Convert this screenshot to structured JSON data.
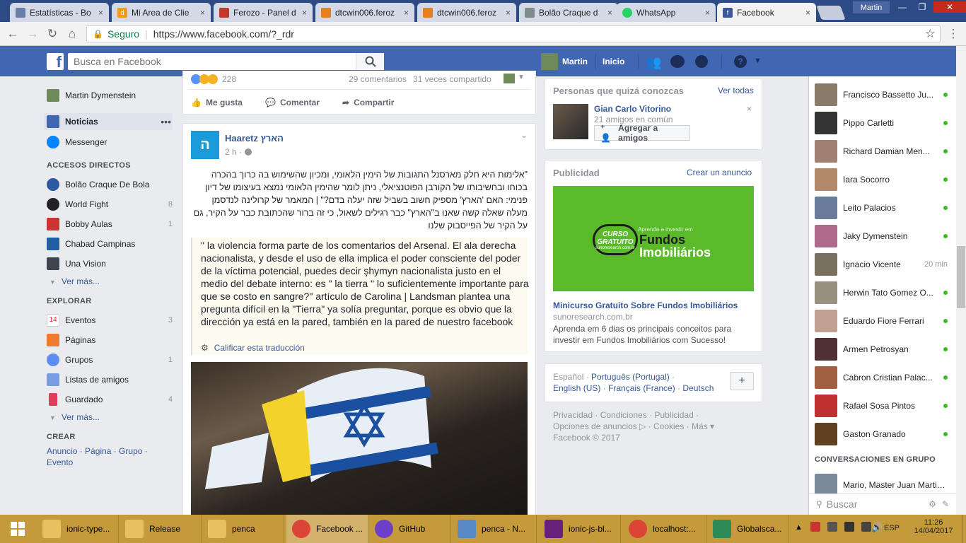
{
  "browser": {
    "tabs": [
      {
        "title": "Estatísticas - Bo",
        "fav_color": "#6a7fa8"
      },
      {
        "title": "Mi Area de Clie",
        "fav_color": "#f39c12"
      },
      {
        "title": "Ferozo - Panel d",
        "fav_color": "#c0392b"
      },
      {
        "title": "dtcwin006.feroz",
        "fav_color": "#e67e22"
      },
      {
        "title": "dtcwin006.feroz",
        "fav_color": "#e67e22"
      },
      {
        "title": "Bolão Craque d",
        "fav_color": "#7f8c8d"
      },
      {
        "title": "WhatsApp",
        "fav_color": "#25d366"
      },
      {
        "title": "Facebook",
        "fav_color": "#3b5998"
      }
    ],
    "user": "Martin",
    "secure_label": "Seguro",
    "url": "https://www.facebook.com/?_rdr"
  },
  "fb_header": {
    "search_placeholder": "Busca en Facebook",
    "user_name": "Martin",
    "home": "Inicio"
  },
  "left_nav": {
    "profile": "Martin Dymenstein",
    "news": "Noticias",
    "messenger": "Messenger",
    "shortcuts_title": "ACCESOS DIRECTOS",
    "shortcuts": [
      {
        "label": "Bolão Craque De Bola",
        "count": ""
      },
      {
        "label": "World Fight",
        "count": "8"
      },
      {
        "label": "Bobby Aulas",
        "count": "1"
      },
      {
        "label": "Chabad Campinas",
        "count": ""
      },
      {
        "label": "Una Vision",
        "count": ""
      }
    ],
    "see_more": "Ver más...",
    "explore_title": "EXPLORAR",
    "explore": [
      {
        "label": "Eventos",
        "count": "3"
      },
      {
        "label": "Páginas",
        "count": ""
      },
      {
        "label": "Grupos",
        "count": "1"
      },
      {
        "label": "Listas de amigos",
        "count": ""
      },
      {
        "label": "Guardado",
        "count": "4"
      }
    ],
    "see_more2": "Ver más...",
    "create_title": "CREAR",
    "create_line1": "Anuncio · Página · Grupo ·",
    "create_line2": "Evento"
  },
  "prev_post": {
    "reactions": "228",
    "comments": "29 comentarios",
    "shares": "31 veces compartido",
    "like": "Me gusta",
    "comment": "Comentar",
    "share": "Compartir"
  },
  "post": {
    "page_name": "Haaretz הארץ",
    "time": "2 h ·",
    "hebrew": "\"אלימות היא חלק מארסנל התגובות של הימין הלאומי, ומכיון שהשימוש בה כרוך בהכרה בכוחו ובחשיבותו של הקורבן הפוטנציאלי, ניתן לומר שהימין הלאומי נמצא בעיצומו של דיון פנימי: האם 'הארץ' מספיק חשוב בשביל שזה יעלה בדם?\" | המאמר של קרולינה לנדסמן מעלה שאלה קשה שאנו ב\"הארץ\" כבר רגילים לשאול, כי זה ברור שהכתובת כבר על הקיר, גם על הקיר של הפייסבוק שלנו",
    "translation": "\" la violencia forma parte de los comentarios del Arsenal. El ala derecha nacionalista, y desde el uso de ella implica el poder consciente del poder de la víctima potencial, puedes decir şhymyn nacionalista justo en el medio del debate interno: es \" la tierra \" lo suficientemente importante para que se costo en sangre?\" artículo de Carolina | Landsman plantea una pregunta difícil en la \"Tierra\" ya solía preguntar, porque es obvio que la dirección ya está en la pared, también en la pared de nuestro facebook",
    "rate": "Calificar esta traducción"
  },
  "pymk": {
    "title": "Personas que quizá conozcas",
    "see_all": "Ver todas",
    "name": "Gian Carlo Vitorino",
    "mutual": "21 amigos en común",
    "add": "Agregar a amigos"
  },
  "ads": {
    "title": "Publicidad",
    "create": "Crear un anuncio",
    "banner_small": "Aprenda a investir em",
    "banner_curso": "CURSO",
    "banner_gratuito": "GRATUITO",
    "banner_site": "sunoresearch.com.br",
    "banner_big1": "Fundos",
    "banner_big2": "Imobiliários",
    "headline": "Minicurso Gratuito Sobre Fundos Imobiliários",
    "domain": "sunoresearch.com.br",
    "desc": "Aprenda em 6 dias os principais conceitos para investir em Fundos Imobiliários com Sucesso!"
  },
  "langs": {
    "line1_a": "Español",
    "line1_b": "Português (Portugal)",
    "line2_a": "English (US)",
    "line2_b": "Français (France)",
    "line2_c": "Deutsch"
  },
  "footer": {
    "line1": "Privacidad · Condiciones · Publicidad ·",
    "line2": "Opciones de anuncios ▷ · Cookies · Más ▾",
    "line3": "Facebook © 2017"
  },
  "chat": {
    "contacts": [
      {
        "name": "Francisco Bassetto Ju...",
        "status": "dot",
        "color": "#8a7a6a"
      },
      {
        "name": "Pippo Carletti",
        "status": "dot",
        "color": "#333333"
      },
      {
        "name": "Richard Damian Men...",
        "status": "dot",
        "color": "#a08070"
      },
      {
        "name": "Iara Socorro",
        "status": "dot",
        "color": "#b08a6a"
      },
      {
        "name": "Leito Palacios",
        "status": "dot",
        "color": "#6a7a9a"
      },
      {
        "name": "Jaky Dymenstein",
        "status": "dot",
        "color": "#b06a8a"
      },
      {
        "name": "Ignacio Vicente",
        "status": "20 min",
        "color": "#7a7060"
      },
      {
        "name": "Herwin Tato Gomez O...",
        "status": "dot",
        "color": "#9a9080"
      },
      {
        "name": "Eduardo Fiore Ferrari",
        "status": "dot",
        "color": "#c0a090"
      },
      {
        "name": "Armen Petrosyan",
        "status": "dot",
        "color": "#503030"
      },
      {
        "name": "Cabron Cristian Palac...",
        "status": "dot",
        "color": "#a06040"
      },
      {
        "name": "Rafael Sosa Pintos",
        "status": "dot",
        "color": "#c03030"
      },
      {
        "name": "Gaston Granado",
        "status": "dot",
        "color": "#604020"
      }
    ],
    "group_title": "CONVERSACIONES EN GRUPO",
    "group_item": "Mario, Master Juan Martin,...",
    "search_placeholder": "Buscar"
  },
  "taskbar": {
    "items": [
      {
        "label": "ionic-type...",
        "color": "#e8c060"
      },
      {
        "label": "Release",
        "color": "#e8c060"
      },
      {
        "label": "penca",
        "color": "#e8c060"
      },
      {
        "label": "Facebook ...",
        "color": "#db4437"
      },
      {
        "label": "GitHub",
        "color": "#6e40c9"
      },
      {
        "label": "penca - N...",
        "color": "#5a8ac6"
      },
      {
        "label": "ionic-js-bl...",
        "color": "#68217a"
      },
      {
        "label": "localhost:...",
        "color": "#db4437"
      },
      {
        "label": "Globalsca...",
        "color": "#2e8b57"
      }
    ],
    "lang": "ESP",
    "time": "11:26",
    "date": "14/04/2017"
  }
}
